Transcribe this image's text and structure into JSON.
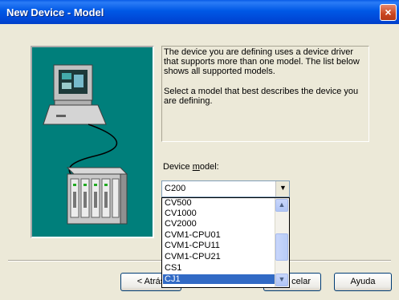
{
  "window": {
    "title": "New Device - Model",
    "close_icon": "×"
  },
  "description": {
    "paragraph1": "The device you are defining uses a device driver that supports more than one model.  The list below shows all supported models.",
    "paragraph2": "Select  a model that best describes the device you are defining."
  },
  "device_model": {
    "label_prefix": "Device ",
    "label_underlined": "m",
    "label_suffix": "odel:",
    "selected_value": "C200",
    "dropdown_arrow": "▼",
    "options": [
      "CV500",
      "CV1000",
      "CV2000",
      "CVM1-CPU01",
      "CVM1-CPU11",
      "CVM1-CPU21",
      "CS1",
      "CJ1"
    ],
    "highlighted_option": "CJ1"
  },
  "buttons": {
    "back_label": "< Atrás",
    "cancel_label": "celar",
    "help_label": "Ayuda"
  },
  "scrollbar": {
    "up_arrow": "▲",
    "down_arrow": "▼"
  },
  "colors": {
    "illustration_background": "#007f7b",
    "selection": "#316ac5",
    "titlebar": "#0058e6"
  }
}
